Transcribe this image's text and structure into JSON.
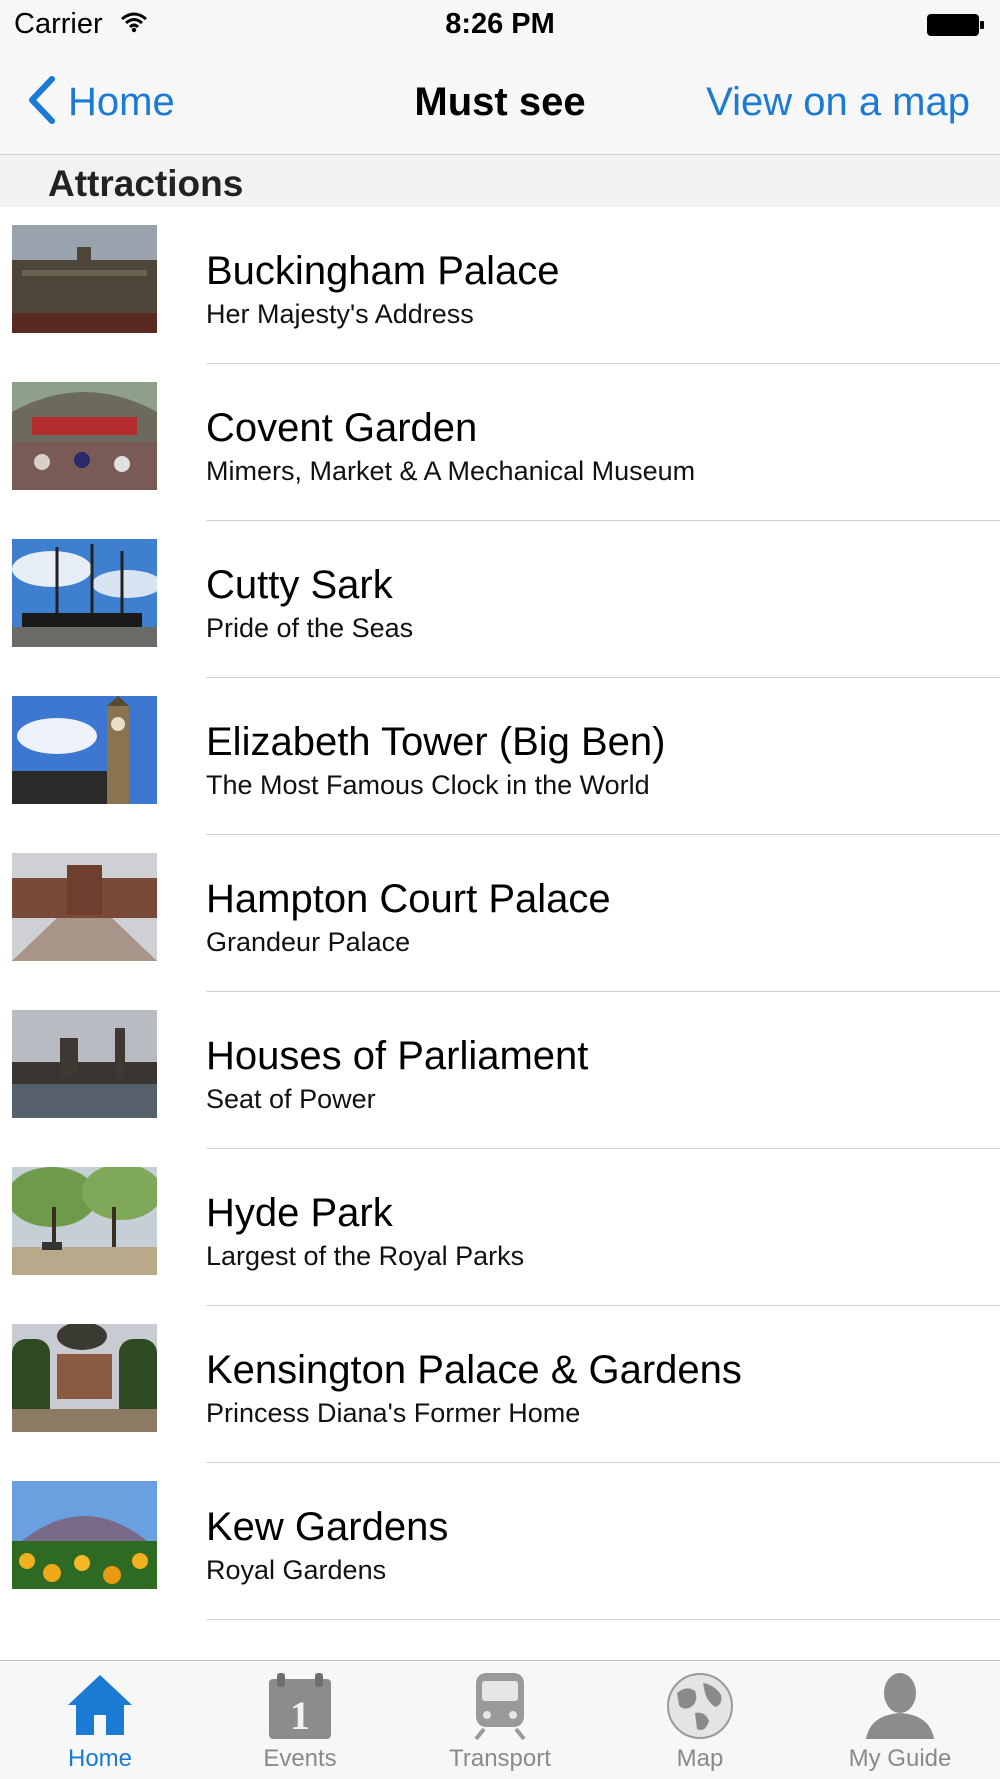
{
  "status_bar": {
    "carrier": "Carrier",
    "time": "8:26 PM"
  },
  "nav": {
    "back_label": "Home",
    "title": "Must see",
    "right_label": "View on a map"
  },
  "section": {
    "title": "Attractions"
  },
  "attractions": [
    {
      "title": "Buckingham Palace",
      "subtitle": "Her Majesty's Address"
    },
    {
      "title": "Covent Garden",
      "subtitle": "Mimers, Market & A Mechanical Museum"
    },
    {
      "title": "Cutty Sark",
      "subtitle": "Pride of the Seas"
    },
    {
      "title": "Elizabeth Tower (Big Ben)",
      "subtitle": "The Most Famous Clock in the World"
    },
    {
      "title": "Hampton Court Palace",
      "subtitle": "Grandeur Palace"
    },
    {
      "title": "Houses of Parliament",
      "subtitle": "Seat of Power"
    },
    {
      "title": "Hyde Park",
      "subtitle": "Largest of the Royal Parks"
    },
    {
      "title": "Kensington Palace & Gardens",
      "subtitle": "Princess Diana's Former Home"
    },
    {
      "title": "Kew Gardens",
      "subtitle": "Royal Gardens"
    }
  ],
  "tabs": [
    {
      "label": "Home",
      "icon": "home-icon",
      "active": true
    },
    {
      "label": "Events",
      "icon": "calendar-icon",
      "active": false
    },
    {
      "label": "Transport",
      "icon": "train-icon",
      "active": false
    },
    {
      "label": "Map",
      "icon": "globe-icon",
      "active": false
    },
    {
      "label": "My Guide",
      "icon": "person-icon",
      "active": false
    }
  ],
  "colors": {
    "accent": "#1a7ad4",
    "inactive_tab": "#8a8a8a",
    "bar_background": "#f7f7f7"
  }
}
